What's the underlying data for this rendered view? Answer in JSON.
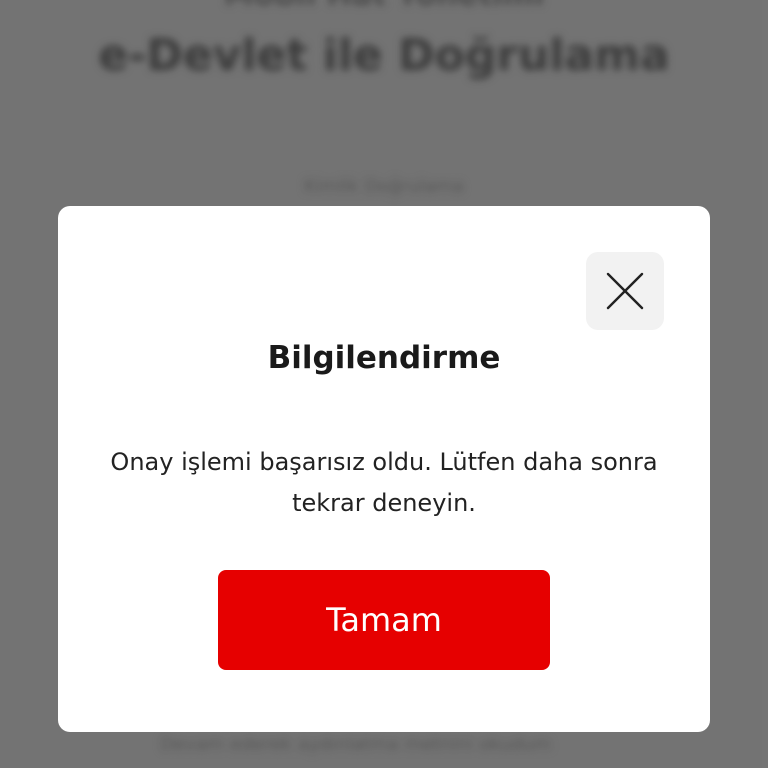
{
  "background": {
    "top_text": "Mobil Hat Yönetimi",
    "title": "e-Devlet ile Doğrulama",
    "subtitle": "Kimlik Doğrulama",
    "bottom_text": "Devam ederek aydınlatma metnini okudum"
  },
  "dialog": {
    "title": "Bilgilendirme",
    "message": "Onay işlemi başarısız oldu. Lütfen daha sonra tekrar deneyin.",
    "ok_label": "Tamam",
    "close_icon": "close-icon"
  },
  "colors": {
    "primary": "#e60000",
    "overlay": "#7a7a7a",
    "dialog_bg": "#ffffff",
    "close_bg": "#f2f2f2"
  }
}
